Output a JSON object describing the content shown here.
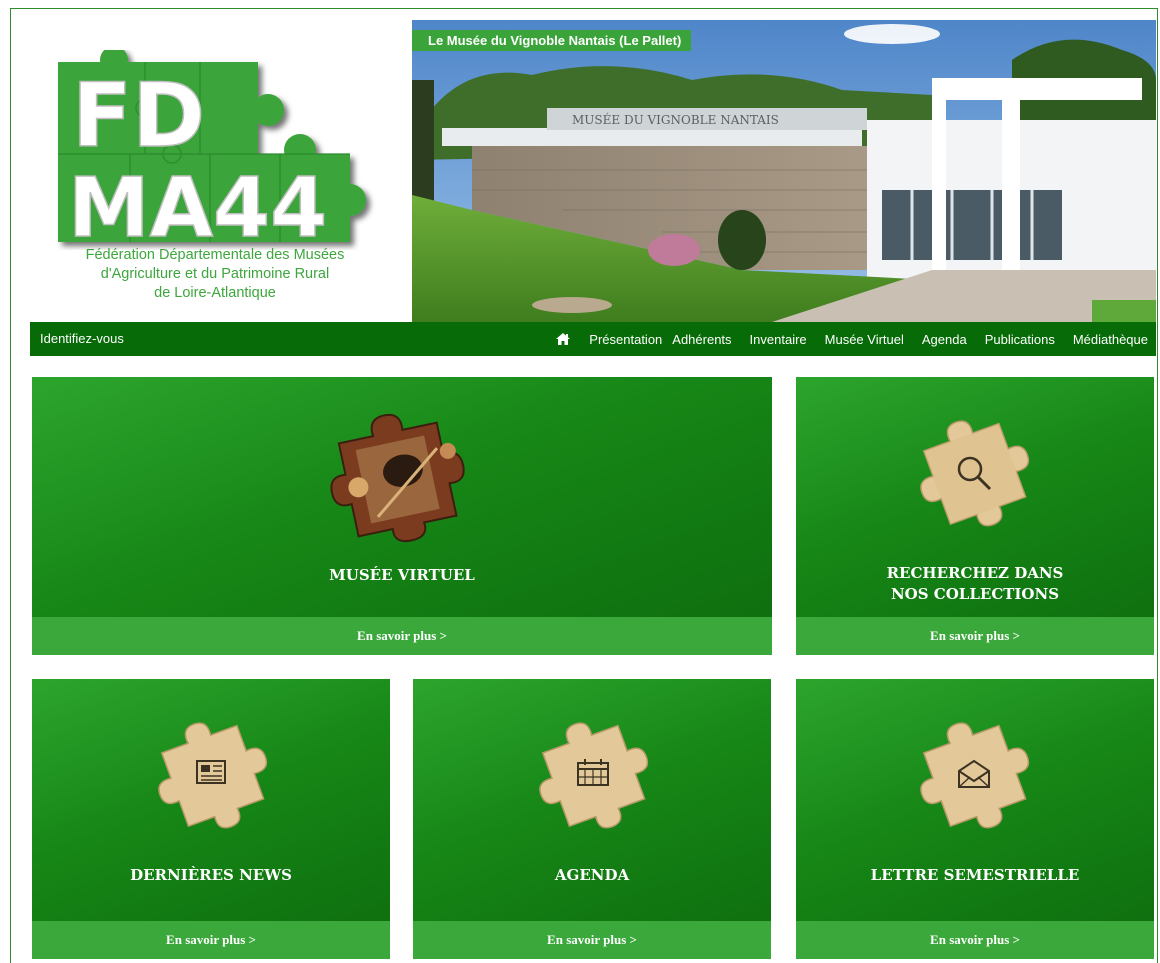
{
  "header": {
    "logo_lines": [
      "FD",
      "MA44"
    ],
    "tagline_lines": [
      "Fédération Départementale des Musées",
      "d'Agriculture et du Patrimoine Rural",
      "de Loire-Atlantique"
    ],
    "hero_caption": "Le Musée du Vignoble Nantais (Le Pallet)",
    "hero_sign_text": "MUSÉE DU VIGNOBLE NANTAIS"
  },
  "nav": {
    "login": "Identifiez-vous",
    "home_icon": "home-icon",
    "items": [
      "Présentation",
      "Adhérents",
      "Inventaire",
      "Musée Virtuel",
      "Agenda",
      "Publications",
      "Médiathèque"
    ]
  },
  "tiles": [
    {
      "title": "MUSÉE VIRTUEL",
      "cta": "En savoir plus >",
      "icon": "photo-puzzle-icon"
    },
    {
      "title_lines": [
        "RECHERCHEZ DANS",
        "NOS COLLECTIONS"
      ],
      "cta": "En savoir plus >",
      "icon": "magnifier-icon"
    },
    {
      "title": "DERNIÈRES NEWS",
      "cta": "En savoir plus >",
      "icon": "newspaper-icon"
    },
    {
      "title": "AGENDA",
      "cta": "En savoir plus >",
      "icon": "calendar-icon"
    },
    {
      "title": "LETTRE SEMESTRIELLE",
      "cta": "En savoir plus >",
      "icon": "envelope-icon"
    }
  ],
  "colors": {
    "brand_green": "#3aa43a",
    "nav_green": "#076b07",
    "tile_dark": "#0d6c0d",
    "puzzle_tan": "#e3c89a"
  }
}
